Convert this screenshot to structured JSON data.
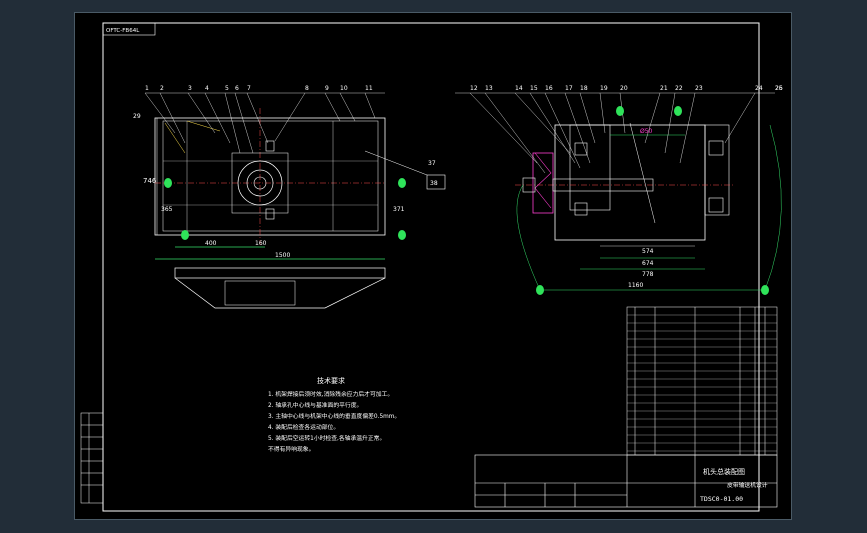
{
  "drawing": {
    "frame_code": "OFTC-FB64L",
    "left_view": {
      "balloons": [
        "1",
        "2",
        "3",
        "4",
        "5",
        "6",
        "7",
        "8",
        "9",
        "10",
        "11",
        "29",
        "37"
      ],
      "detail_box": "38",
      "dims": {
        "height_total": "746",
        "height_inner": "365",
        "height_right": "371",
        "bottom_a": "400",
        "bottom_b": "160",
        "bottom_total": "1500"
      }
    },
    "right_view": {
      "balloons": [
        "12",
        "13",
        "14",
        "15",
        "16",
        "17",
        "18",
        "19",
        "20",
        "21",
        "22",
        "23",
        "24",
        "25",
        "26"
      ],
      "dims": {
        "top": "Ø50",
        "d1": "574",
        "d2": "674",
        "d3": "778",
        "d4": "1160"
      }
    },
    "notes": {
      "title": "技术要求",
      "lines": [
        "1. 机架焊接后须时效,消除残余应力后才可加工。",
        "2. 轴承孔中心线与基准面的平行度。",
        "3. 主轴中心线与机架中心线的垂直度偏差0.5mm。",
        "4. 装配后检查各运动部位。",
        "5. 装配后空运转1小时检查,各轴承温升正常。",
        "   不得有异响现象。"
      ]
    },
    "title_block": {
      "name": "机头总装配图",
      "org": "皮带输送机设计",
      "code": "TDSC0-01.00"
    }
  }
}
